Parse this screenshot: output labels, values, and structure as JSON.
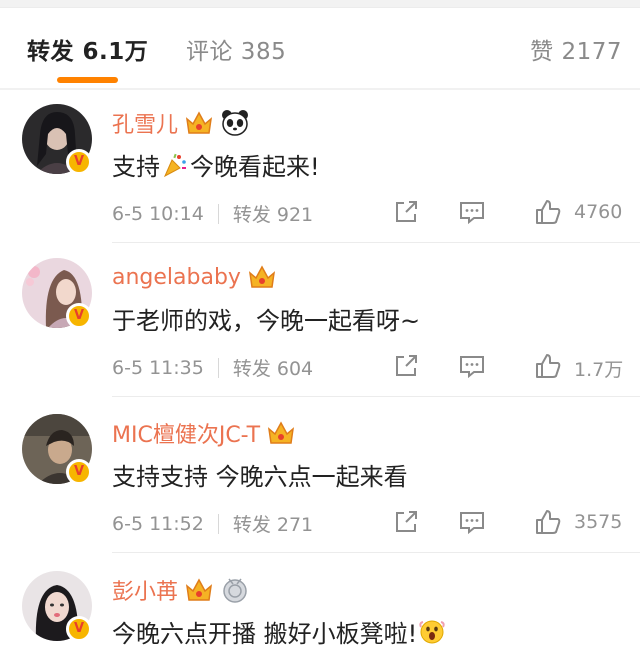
{
  "tabs": {
    "repost_label": "转发 6.1万",
    "comment_label": "评论 385",
    "like_label": "赞 2177"
  },
  "colors": {
    "accent": "#ff8200",
    "username": "#eb7350",
    "verified_badge": "#f7b500"
  },
  "comments": [
    {
      "username": "孔雪儿",
      "badges": [
        "crown-badge-icon",
        "panda-icon"
      ],
      "text_before_emoji": "支持",
      "emoji": "party-popper-icon",
      "text_after_emoji": "今晚看起来!",
      "time": "6-5 10:14",
      "repost_label": "转发 921",
      "like_count": "4760"
    },
    {
      "username": "angelababy",
      "badges": [
        "crown-badge-icon"
      ],
      "text": "于老师的戏，今晚一起看呀~",
      "time": "6-5 11:35",
      "repost_label": "转发 604",
      "like_count": "1.7万"
    },
    {
      "username": "MIC檀健次JC-T",
      "badges": [
        "crown-badge-icon"
      ],
      "text": "支持支持 今晚六点一起来看",
      "time": "6-5 11:52",
      "repost_label": "转发 271",
      "like_count": "3575"
    },
    {
      "username": "彭小苒",
      "badges": [
        "crown-badge-icon",
        "medal-icon"
      ],
      "text_before_emoji": "今晚六点开播 搬好小板凳啦!",
      "emoji": "screaming-face-icon"
    }
  ]
}
